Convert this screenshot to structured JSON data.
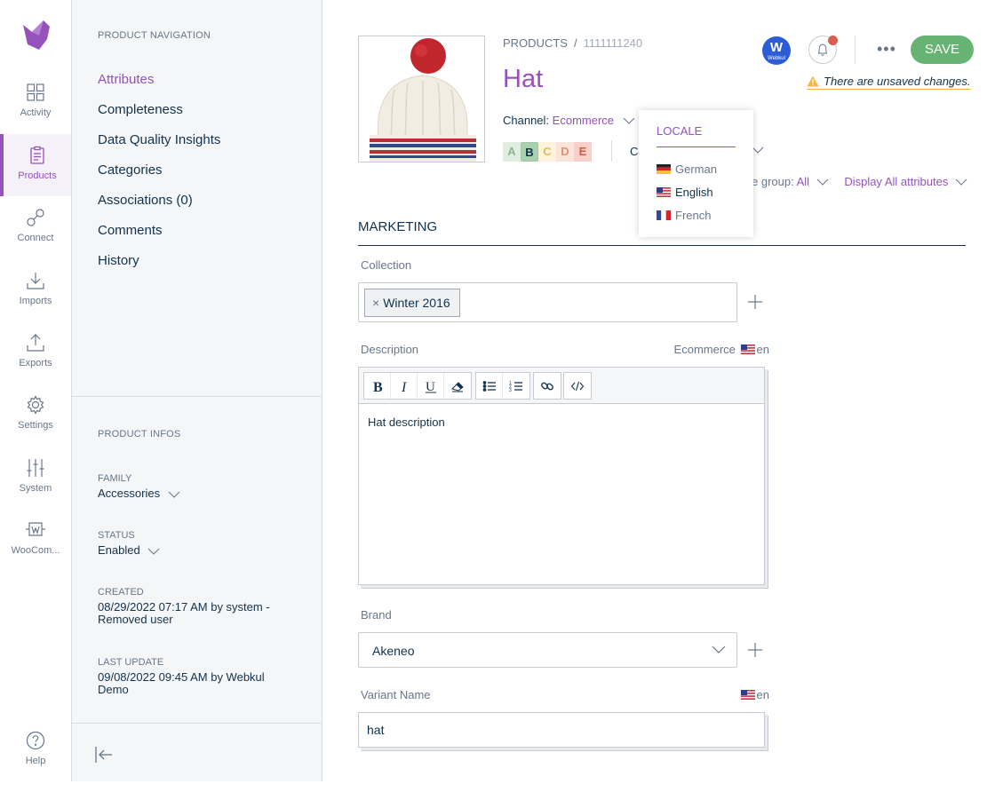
{
  "main_menu": {
    "items": [
      {
        "label": "Activity",
        "icon": "dashboard-icon"
      },
      {
        "label": "Products",
        "icon": "clipboard-icon"
      },
      {
        "label": "Connect",
        "icon": "connect-icon"
      },
      {
        "label": "Imports",
        "icon": "import-icon"
      },
      {
        "label": "Exports",
        "icon": "export-icon"
      },
      {
        "label": "Settings",
        "icon": "gear-icon"
      },
      {
        "label": "System",
        "icon": "sliders-icon"
      },
      {
        "label": "WooCom...",
        "icon": "woocommerce-icon"
      }
    ],
    "help_label": "Help",
    "active": "Products",
    "accent_color": "#9452ba"
  },
  "product_nav": {
    "title": "PRODUCT NAVIGATION",
    "items": [
      "Attributes",
      "Completeness",
      "Data Quality Insights",
      "Categories",
      "Associations (0)",
      "Comments",
      "History"
    ],
    "active": "Attributes"
  },
  "product_infos": {
    "title": "PRODUCT INFOS",
    "family_label": "FAMILY",
    "family_value": "Accessories",
    "status_label": "STATUS",
    "status_value": "Enabled",
    "created_label": "CREATED",
    "created_value": "08/29/2022 07:17 AM by system - Removed user",
    "last_update_label": "LAST UPDATE",
    "last_update_value": "09/08/2022 09:45 AM by Webkul Demo"
  },
  "header": {
    "breadcrumb_root": "PRODUCTS",
    "breadcrumb_sep": "/",
    "breadcrumb_id": "1111111240",
    "title": "Hat",
    "channel_label": "Channel:",
    "channel_value": "Ecommerce",
    "grades": [
      "A",
      "B",
      "C",
      "D",
      "E"
    ],
    "selected_grade": "B",
    "completeness_prefix": "Co",
    "attribute_group_label": "e group:",
    "attribute_group_value": "All",
    "display_attributes": "Display All attributes",
    "webkul_icon_text": "W",
    "webkul_icon_sub": "Webkul",
    "more_label": "•••",
    "save_label": "SAVE",
    "save_color": "#67b373",
    "unsaved_text": "There are unsaved changes."
  },
  "locale_dropdown": {
    "title": "LOCALE",
    "items": [
      {
        "label": "German",
        "flag": "de-flag-icon"
      },
      {
        "label": "English",
        "flag": "us-flag-icon",
        "selected": true
      },
      {
        "label": "French",
        "flag": "fr-flag-icon"
      }
    ]
  },
  "attributes": {
    "group_title": "MARKETING",
    "collection": {
      "label": "Collection",
      "tags": [
        "Winter 2016"
      ]
    },
    "description": {
      "label": "Description",
      "scope": "Ecommerce",
      "locale": "en",
      "content": "Hat description",
      "toolbar": [
        "bold-icon",
        "italic-icon",
        "underline-icon",
        "eraser-icon",
        "bullet-list-icon",
        "numbered-list-icon",
        "link-icon",
        "code-icon"
      ]
    },
    "brand": {
      "label": "Brand",
      "value": "Akeneo"
    },
    "variant_name": {
      "label": "Variant Name",
      "locale": "en",
      "value": "hat"
    }
  }
}
